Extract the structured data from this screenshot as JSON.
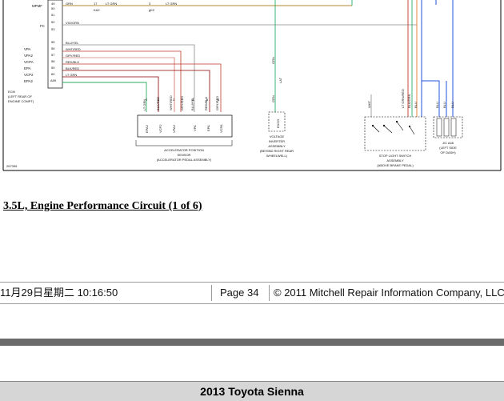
{
  "diagram": {
    "top_rows": [
      {
        "label": "MPMF",
        "pin": "49",
        "wire": "GRN",
        "pin2": "17",
        "wire2": "LT GRN",
        "ref": "KA2",
        "pin3": "3",
        "wire3": "LT GRN",
        "ref2": "gK2"
      },
      {
        "label": "",
        "pin": "50"
      },
      {
        "label": "",
        "pin": "51"
      },
      {
        "label": "FC",
        "pin": "52",
        "wire": "VIO/GRN"
      },
      {
        "label": "",
        "pin": "53"
      }
    ],
    "ecm_pins": [
      {
        "label": "",
        "pin": "55",
        "wire": "BLU/YEL"
      },
      {
        "label": "VPA",
        "pin": "56",
        "wire": "WHT/RED"
      },
      {
        "label": "VPA2",
        "pin": "57",
        "wire": "GRY/RED"
      },
      {
        "label": "VCPA",
        "pin": "58",
        "wire": "RED/BLK"
      },
      {
        "label": "EPA",
        "pin": "59",
        "wire": "BLK/RED"
      },
      {
        "label": "VCP2",
        "pin": "60",
        "wire": "LT GRN"
      },
      {
        "label": "EPA2",
        "pin": "A59",
        "wire": ""
      }
    ],
    "ecm_note": [
      "ECM",
      "(LEFT REAR OF",
      "ENGINE COMPT)"
    ],
    "sensor_wires": [
      "LT GRN",
      "BLK/RED",
      "WHT/RED",
      "GRY/RED",
      "BLU/YEL",
      "RED/BLK",
      "GRY/RED"
    ],
    "sensor_pins": [
      "EPA2",
      "VCP2",
      "VPA2",
      "VPA",
      "EPA",
      "VCPA"
    ],
    "sensor_pin_numbers": [
      "2",
      "1",
      "3",
      "4",
      "5",
      "6"
    ],
    "sensor_label": [
      "ACCELERATOR POSITION",
      "SENSOR",
      "(ACCELERATOR PEDAL ASSEMBLY)"
    ],
    "inverter_wires": [
      "GRN",
      "LAT",
      "GRN"
    ],
    "inverter_pin": "EXCO",
    "inverter_label": [
      "VOLTAGE",
      "INVERTER",
      "ASSEMBLY",
      "(BEHIND RIGHT REAR",
      "WHEELWELL)"
    ],
    "stop_wires": [
      "WHT",
      "LT GRN/RED",
      "BLK/GRN",
      "BLU"
    ],
    "stop_label": [
      "STOP LIGHT SWITCH",
      "ASSEMBLY",
      "(ABOVE BRAKE PEDAL)"
    ],
    "jc_wires": [
      "BLU",
      "BLU",
      "BLU"
    ],
    "jc_label": [
      "J/C A46",
      "(LEFT SIDE",
      "OF DASH)"
    ],
    "figure_id": "267395"
  },
  "caption": "3.5L, Engine Performance Circuit (1 of 6)",
  "footer": {
    "timestamp": "11月29日星期二  10:16:50",
    "page": "Page 34",
    "copyright": "© 2011 Mitchell Repair Information Company, LLC"
  },
  "vehicle_title": "2013 Toyota Sienna",
  "colors": {
    "wire_red": "#c0392b",
    "wire_green": "#27ae60",
    "wire_blue": "#2350d8",
    "wire_olive": "#b08a2e",
    "wire_gray": "#8a8a8a",
    "wire_orange": "#e07a2a",
    "footer_bar": "#6b6b6b",
    "title_bar": "#d6d6d6"
  }
}
